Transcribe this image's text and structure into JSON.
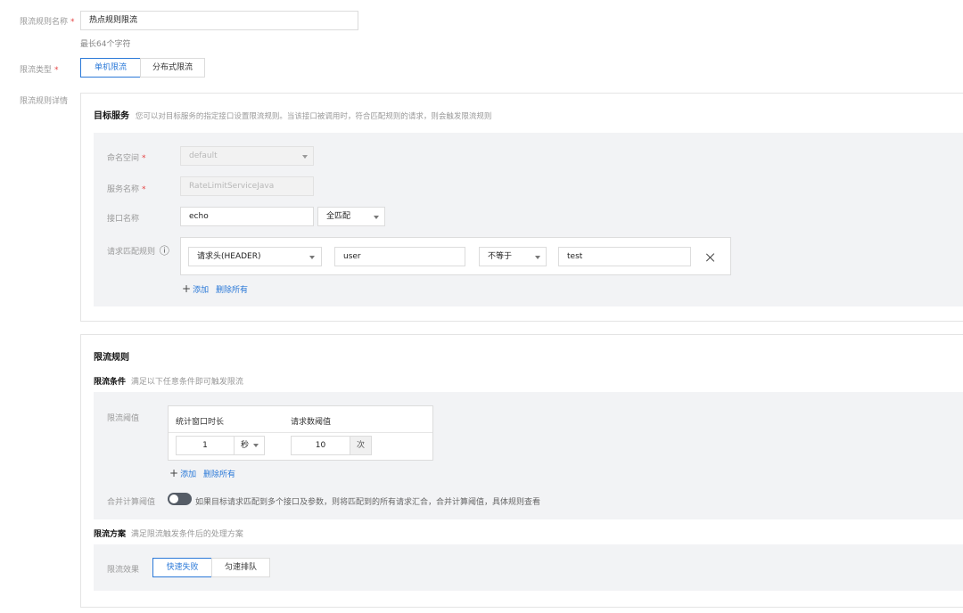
{
  "form": {
    "rule_name_label": "限流规则名称",
    "rule_name_value": "热点规则限流",
    "rule_name_hint": "最长64个字符",
    "type_label": "限流类型",
    "type_options": [
      "单机限流",
      "分布式限流"
    ],
    "type_selected": "单机限流",
    "detail_label": "限流规则详情"
  },
  "target": {
    "title": "目标服务",
    "desc": "您可以对目标服务的指定接口设置限流规则。当该接口被调用时，符合匹配规则的请求，则会触发限流规则",
    "namespace_label": "命名空间",
    "namespace_value": "default",
    "service_label": "服务名称",
    "service_value": "RateLimitServiceJava",
    "interface_label": "接口名称",
    "interface_value": "echo",
    "match_mode": "全匹配",
    "match_rule_label": "请求匹配规则",
    "info_icon": "ⓘ",
    "rule": {
      "type": "请求头(HEADER)",
      "key": "user",
      "operator": "不等于",
      "value": "test"
    },
    "add_label": "添加",
    "delete_all_label": "删除所有"
  },
  "limit": {
    "title": "限流规则",
    "cond_title": "限流条件",
    "cond_desc": "满足以下任意条件即可触发限流",
    "threshold_label": "限流阈值",
    "col_window": "统计窗口时长",
    "col_count": "请求数阈值",
    "window_value": "1",
    "window_unit": "秒",
    "count_value": "10",
    "count_unit": "次",
    "add_label": "添加",
    "delete_all_label": "删除所有",
    "merge_label": "合并计算阈值",
    "merge_enabled": false,
    "merge_desc": "如果目标请求匹配到多个接口及参数，则将匹配到的所有请求汇合，合并计算阈值，具体规则查看",
    "plan_title": "限流方案",
    "plan_desc": "满足限流触发条件后的处理方案",
    "effect_label": "限流效果",
    "effect_options": [
      "快速失败",
      "匀速排队"
    ],
    "effect_selected": "快速失败"
  },
  "colors": {
    "accent": "#2b79d8",
    "required": "#e54545",
    "panel_bg": "#f2f3f5",
    "toggle_off": "#555c66"
  }
}
